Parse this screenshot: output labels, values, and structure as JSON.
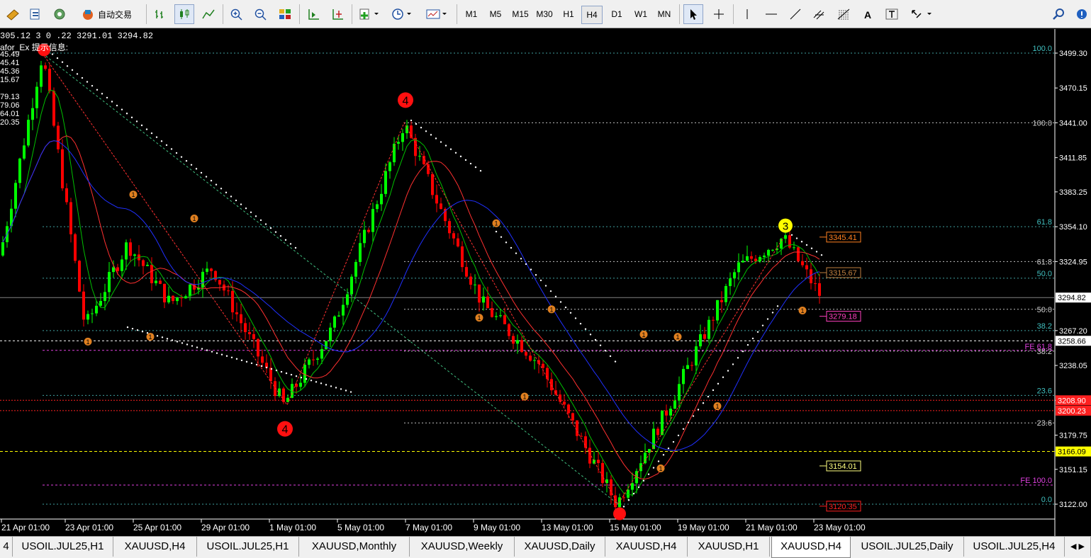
{
  "toolbar": {
    "autotrade_label": "自动交易",
    "timeframes": [
      "M1",
      "M5",
      "M15",
      "M30",
      "H1",
      "H4",
      "D1",
      "W1",
      "MN"
    ],
    "active_timeframe": "H4"
  },
  "header": {
    "ohlc": "305.12 3 0 .22 3291.01 3294.82",
    "indicator_label": "afor_Ex 提示信息:",
    "indicator_values": [
      "45.49",
      "45.41",
      "45.36",
      "15.67",
      "",
      "79.13",
      "79.06",
      "64.01",
      "20.35"
    ]
  },
  "price_axis": {
    "labels": [
      "3499.30",
      "3470.15",
      "3441.00",
      "3411.85",
      "3383.25",
      "3354.10",
      "3324.95",
      "3267.20",
      "3238.05",
      "3208.90",
      "3179.75",
      "3151.15",
      "3122.00"
    ],
    "current_price": "3294.82",
    "tag_3258": "3258.66",
    "tag_3208": "3208.90",
    "tag_3200": "3200.23",
    "tag_3166": "3166.09",
    "colors": {
      "current": "#ffffff",
      "tag_3258": "#ffffff",
      "tag_3208": "#ff2020",
      "tag_3200": "#ff2020",
      "tag_3166": "#ffff00"
    }
  },
  "time_axis": {
    "labels": [
      "21 Apr 01:00",
      "23 Apr 01:00",
      "25 Apr 01:00",
      "29 Apr 01:00",
      "1 May 01:00",
      "5 May 01:00",
      "7 May 01:00",
      "9 May 01:00",
      "13 May 01:00",
      "15 May 01:00",
      "19 May 01:00",
      "21 May 01:00",
      "23 May 01:00"
    ]
  },
  "fib_labels": {
    "left": {
      "l100": "100.0",
      "l618": "61.8",
      "l500": "50.0",
      "l382": "38.2",
      "l236": "23.6",
      "l0": "0.0"
    },
    "right": {
      "r100": "100.0",
      "r618": "61.8",
      "r382": "38.2",
      "r236": "23.6",
      "r50": "50.0"
    },
    "fe618": "FE 61.8",
    "fe100": "FE 100.0"
  },
  "boxed_prices": {
    "p3345": "3345.41",
    "p3315": "3315.67",
    "p3279": "3279.18",
    "p3154": "3154.01",
    "p3120": "3120.35"
  },
  "wave_markers": {
    "red_4_top": "4",
    "red_4_bottom": "4",
    "yellow_3": "3",
    "small_1": "1"
  },
  "colors": {
    "candle_up": "#00ff00",
    "candle_down": "#ff0000",
    "ma_fast": "#00c000",
    "ma_mid": "#ff3030",
    "ma_slow": "#2030ff",
    "fib": "#40c0c0",
    "fe": "#e040e0"
  },
  "tabs": [
    "USOIL.JUL25,H1",
    "XAUUSD,H4",
    "USOIL.JUL25,H1",
    "XAUUSD,Monthly",
    "XAUUSD,Weekly",
    "XAUUSD,Daily",
    "XAUUSD,H4",
    "XAUUSD,H1",
    "XAUUSD,H4",
    "USOIL.JUL25,Daily",
    "USOIL.JUL25,H4"
  ],
  "active_tab_index": 8
}
